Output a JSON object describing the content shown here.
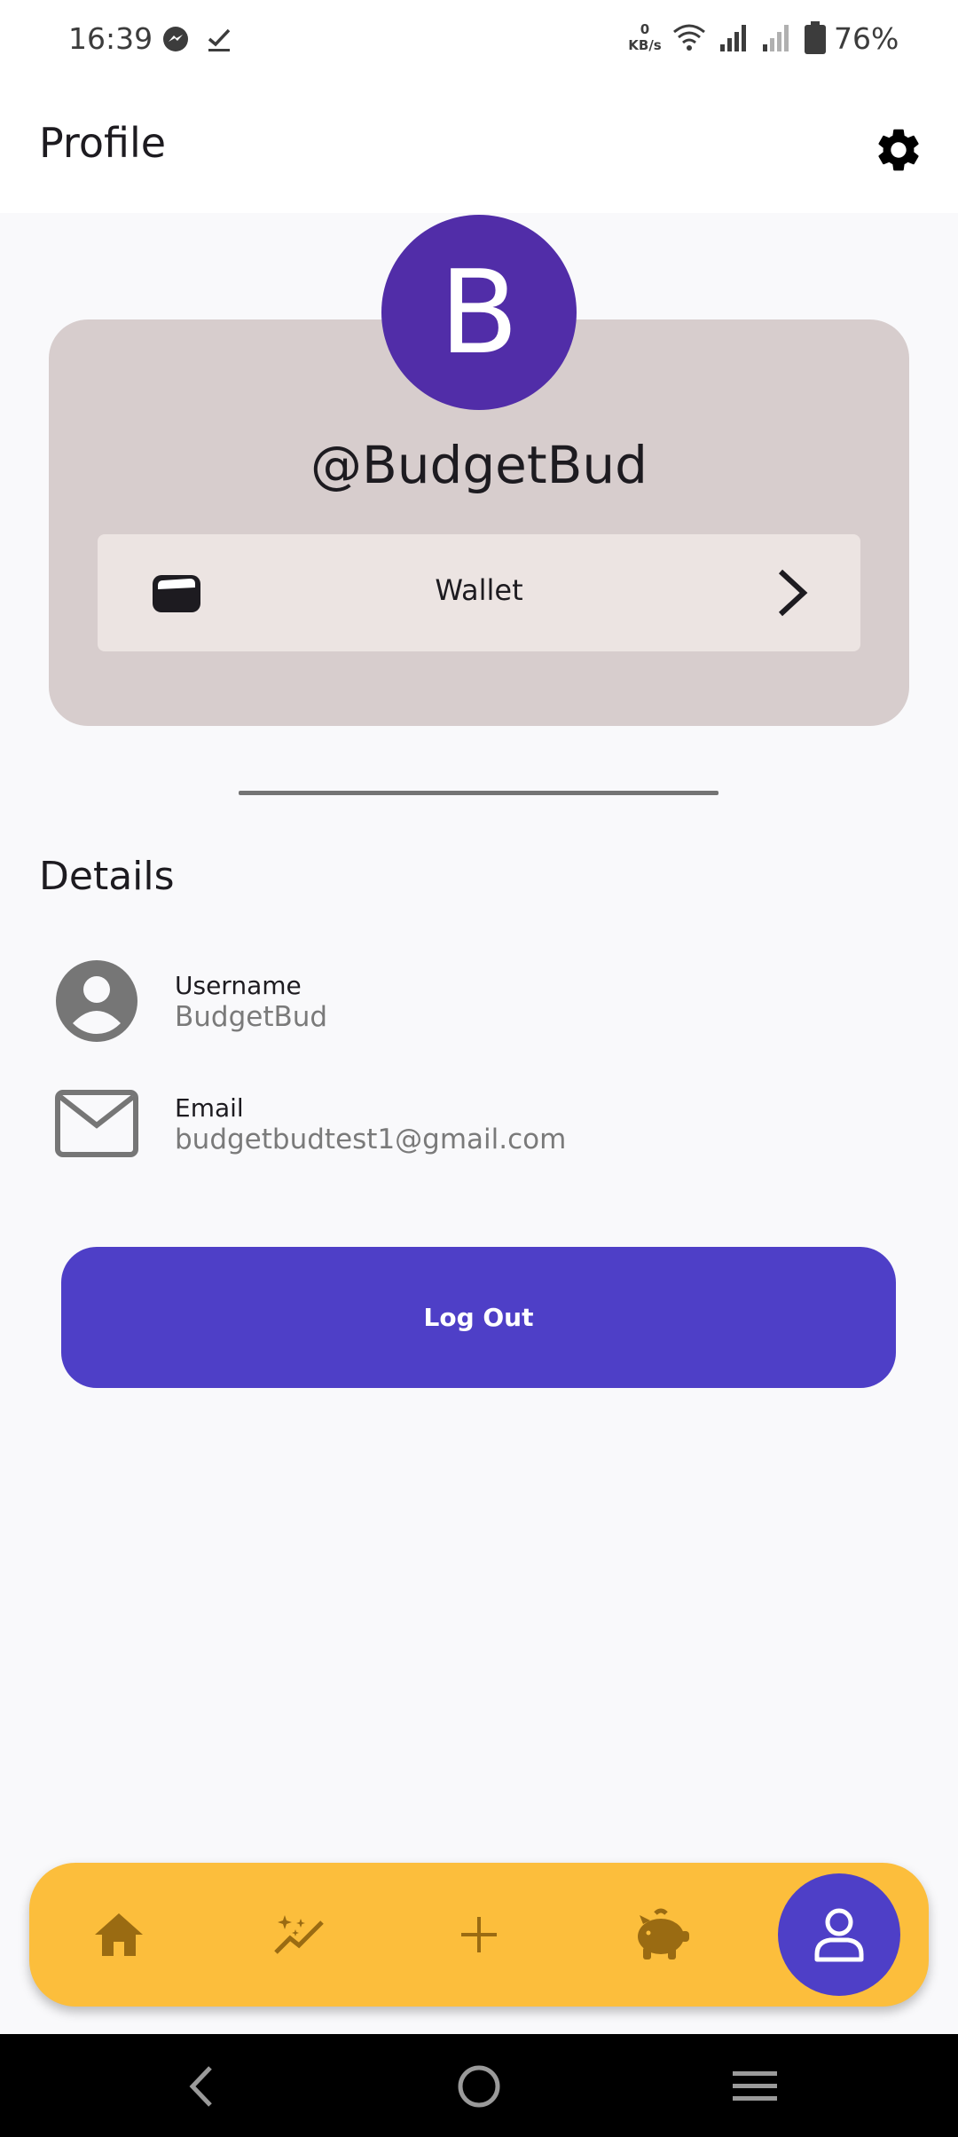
{
  "status_bar": {
    "time": "16:39",
    "net_speed_value": "0",
    "net_speed_unit": "KB/s",
    "battery": "76%"
  },
  "app_bar": {
    "title": "Profile"
  },
  "profile": {
    "avatar_letter": "B",
    "handle": "@BudgetBud",
    "wallet_label": "Wallet"
  },
  "details": {
    "title": "Details",
    "username_label": "Username",
    "username_value": "BudgetBud",
    "email_label": "Email",
    "email_value": "budgetbudtest1@gmail.com"
  },
  "logout": {
    "label": "Log Out"
  },
  "bottom_nav": {
    "items": [
      {
        "icon": "home-icon"
      },
      {
        "icon": "sparkle-chart-icon"
      },
      {
        "icon": "plus-icon"
      },
      {
        "icon": "piggy-bank-icon"
      },
      {
        "icon": "person-icon",
        "active": true
      }
    ]
  },
  "colors": {
    "accent": "#4e3fc7",
    "avatar": "#512da8",
    "nav_bar": "#fcbe3c",
    "nav_icon": "#9a6b12",
    "card": "#d7cdcd"
  }
}
